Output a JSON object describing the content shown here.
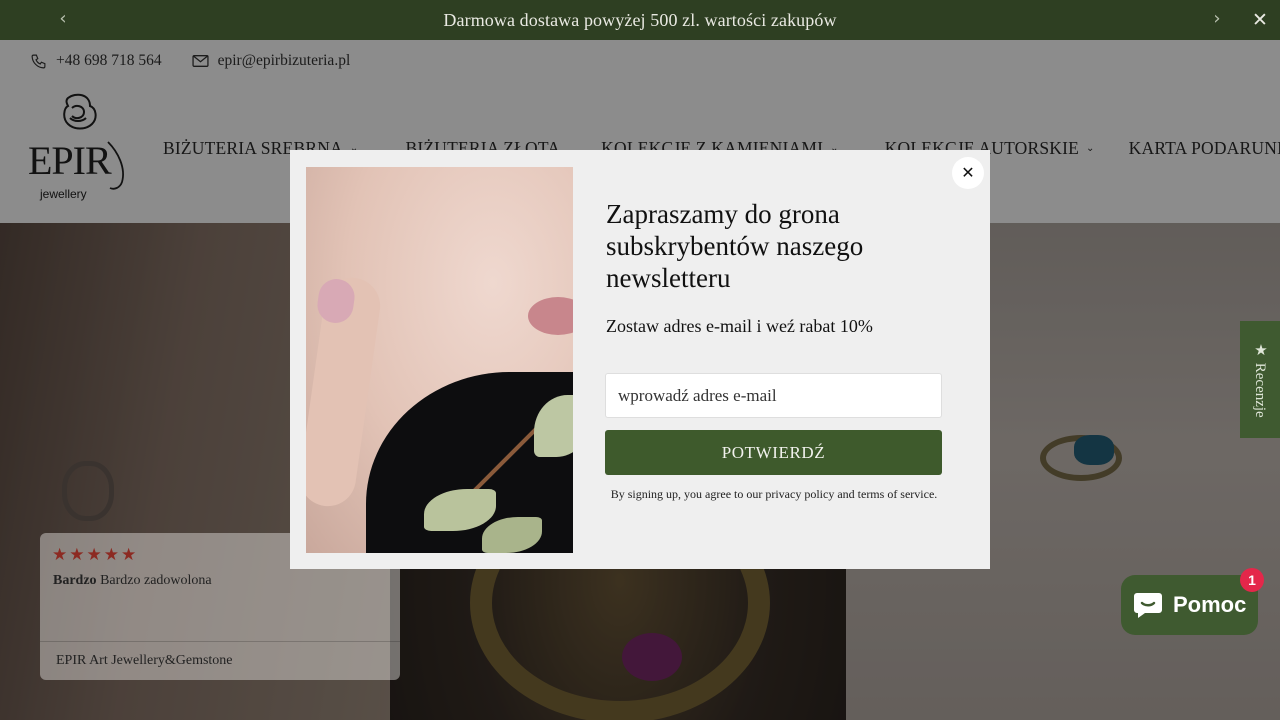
{
  "announcement": {
    "text": "Darmowa dostawa powyżej 500 zl. wartości zakupów",
    "prev_icon": "chevron-left-icon",
    "next_icon": "chevron-right-icon",
    "close_icon": "close-icon"
  },
  "contact": {
    "phone": "+48 698 718 564",
    "email": "epir@epirbizuteria.pl"
  },
  "logo": {
    "brand": "EPIR",
    "tagline": "jewellery"
  },
  "nav": {
    "items": [
      {
        "label": "BIŻUTERIA SREBRNA",
        "has_dropdown": true
      },
      {
        "label": "BIŻUTERIA ZŁOTA",
        "has_dropdown": false
      },
      {
        "label": "KOLEKCJE Z KAMIENIAMI",
        "has_dropdown": true
      },
      {
        "label": "KOLEKCJE AUTORSKIE",
        "has_dropdown": true
      },
      {
        "label": "KARTA PODARUNKOWA",
        "has_dropdown": false
      }
    ]
  },
  "review": {
    "stars": "★★★★★",
    "author": "Bardzo",
    "text": "Bardzo zadowolona",
    "store": "EPIR Art Jewellery&Gemstone"
  },
  "side_tab": {
    "label": "★ Recenzje"
  },
  "chat": {
    "label": "Pomoc",
    "badge": "1"
  },
  "modal": {
    "title": "Zapraszamy do grona subskrybentów naszego newsletteru",
    "subtitle": "Zostaw adres e-mail i weź rabat 10%",
    "email_placeholder": "wprowadź adres e-mail",
    "confirm_label": "POTWIERDŹ",
    "legal": "By signing up, you agree to our privacy policy and terms of service.",
    "close_symbol": "✕"
  },
  "colors": {
    "announcement_bg": "#2e3f22",
    "accent_green": "#3e5a2c",
    "star_red": "#8c2a22",
    "badge_red": "#e4274a"
  }
}
